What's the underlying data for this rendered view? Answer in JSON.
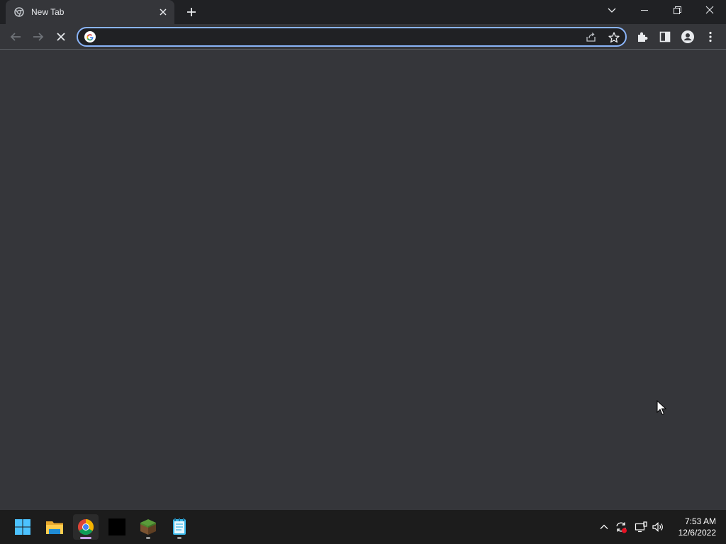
{
  "browser": {
    "tab": {
      "title": "New Tab"
    },
    "omnibox": {
      "value": "",
      "placeholder": ""
    }
  },
  "taskbar": {
    "apps": [
      {
        "name": "start",
        "icon": "windows-logo-icon"
      },
      {
        "name": "file-explorer",
        "icon": "folder-icon"
      },
      {
        "name": "chrome",
        "icon": "chrome-icon",
        "active": true
      },
      {
        "name": "terminal",
        "icon": "black-window-icon"
      },
      {
        "name": "minecraft",
        "icon": "grass-block-icon"
      },
      {
        "name": "notepad",
        "icon": "notepad-icon"
      }
    ],
    "clock": {
      "time": "7:53 AM",
      "date": "12/6/2022"
    }
  },
  "colors": {
    "accent": "#8ab4f8",
    "tab_bg": "#35363a",
    "titlebar_bg": "#202124",
    "taskbar_bg": "#1c1c1c"
  }
}
